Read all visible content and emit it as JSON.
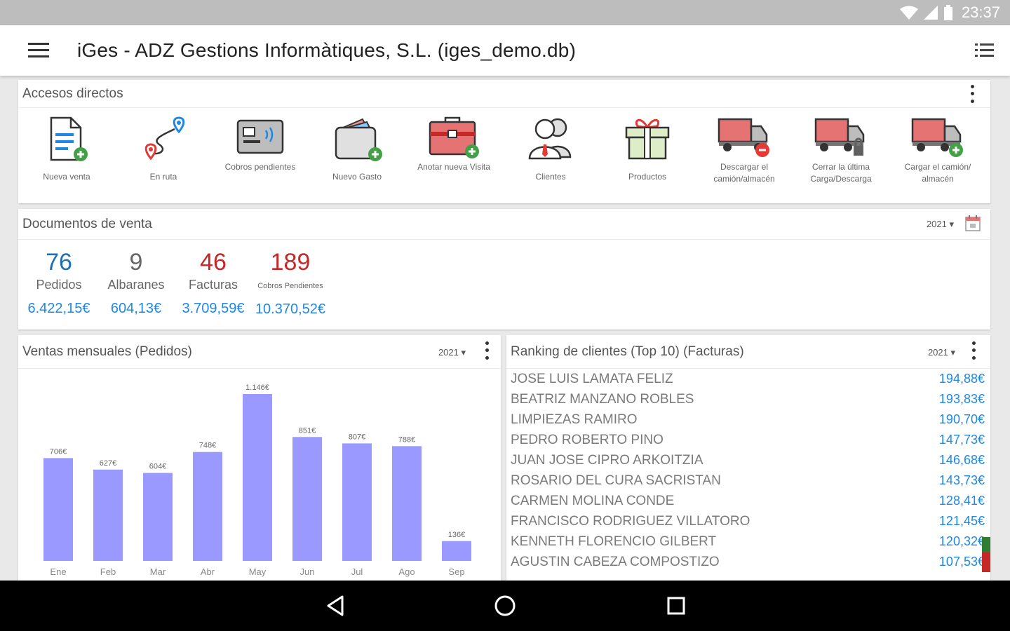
{
  "status": {
    "time": "23:37"
  },
  "app": {
    "title": "iGes - ADZ Gestions Informàtiques, S.L. (iges_demo.db)"
  },
  "shortcuts": {
    "title": "Accesos directos",
    "items": [
      {
        "label": "Nueva venta",
        "icon": "new-sale-icon"
      },
      {
        "label": "En ruta",
        "icon": "route-icon"
      },
      {
        "label": "Cobros pendientes",
        "icon": "pending-payments-icon"
      },
      {
        "label": "Nuevo Gasto",
        "icon": "new-expense-icon"
      },
      {
        "label": "Anotar nueva Visita",
        "icon": "new-visit-icon"
      },
      {
        "label": "Clientes",
        "icon": "clients-icon"
      },
      {
        "label": "Productos",
        "icon": "products-icon"
      },
      {
        "label": "Descargar el camión/almacén",
        "icon": "unload-truck-icon"
      },
      {
        "label": "Cerrar la última Carga/Descarga",
        "icon": "close-load-truck-icon"
      },
      {
        "label": "Cargar el camión/ almacén",
        "icon": "load-truck-icon"
      }
    ]
  },
  "sales_docs": {
    "title": "Documentos de venta",
    "year": "2021 ▾",
    "stats": [
      {
        "value": "76",
        "label": "Pedidos",
        "amount": "6.422,15€",
        "color": "#1f6fb2"
      },
      {
        "value": "9",
        "label": "Albaranes",
        "amount": "604,13€",
        "color": "#666666"
      },
      {
        "value": "46",
        "label": "Facturas",
        "amount": "3.709,59€",
        "color": "#c62828"
      },
      {
        "value": "189",
        "label": "Cobros Pendientes",
        "amount": "10.370,52€",
        "color": "#c62828"
      }
    ]
  },
  "monthly": {
    "title": "Ventas mensuales (Pedidos)",
    "year": "2021 ▾"
  },
  "chart_data": {
    "type": "bar",
    "categories": [
      "Ene",
      "Feb",
      "Mar",
      "Abr",
      "May",
      "Jun",
      "Jul",
      "Ago",
      "Sep"
    ],
    "values": [
      706,
      627,
      604,
      748,
      1146,
      851,
      807,
      788,
      136
    ],
    "labels": [
      "706€",
      "627€",
      "604€",
      "748€",
      "1.146€",
      "851€",
      "807€",
      "788€",
      "136€"
    ],
    "bar_color": "#9999ff",
    "ylim": [
      0,
      1146
    ]
  },
  "ranking": {
    "title": "Ranking de clientes (Top 10) (Facturas)",
    "year": "2021 ▾",
    "rows": [
      {
        "name": "JOSE LUIS LAMATA FELIZ",
        "value": "194,88€"
      },
      {
        "name": "BEATRIZ MANZANO ROBLES",
        "value": "193,83€"
      },
      {
        "name": "LIMPIEZAS RAMIRO",
        "value": "190,70€"
      },
      {
        "name": "PEDRO ROBERTO PINO",
        "value": "147,73€"
      },
      {
        "name": "JUAN JOSE CIPRO ARKOITZIA",
        "value": "146,68€"
      },
      {
        "name": "ROSARIO DEL CURA SACRISTAN",
        "value": "143,73€"
      },
      {
        "name": "CARMEN MOLINA CONDE",
        "value": "128,41€"
      },
      {
        "name": "FRANCISCO RODRIGUEZ VILLATORO",
        "value": "121,45€"
      },
      {
        "name": "KENNETH FLORENCIO GILBERT",
        "value": "120,32€"
      },
      {
        "name": "AGUSTIN CABEZA COMPOSTIZO",
        "value": "107,53€"
      }
    ]
  }
}
